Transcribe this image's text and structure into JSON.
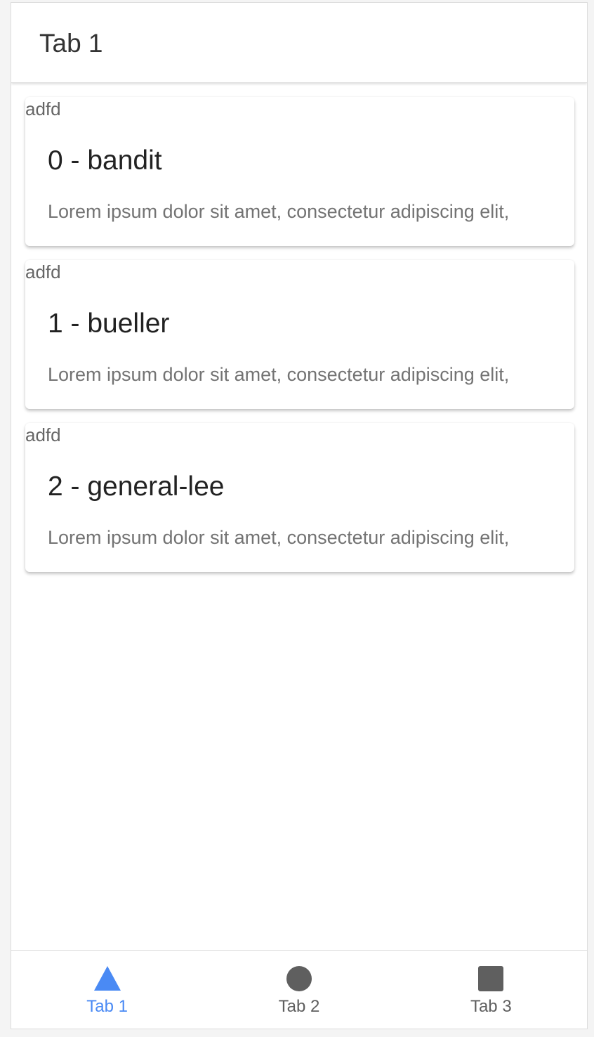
{
  "header": {
    "title": "Tab 1"
  },
  "cards": [
    {
      "tag": "adfd",
      "title": "0 - bandit",
      "body": "Lorem ipsum dolor sit amet, consectetur adipiscing elit,"
    },
    {
      "tag": "adfd",
      "title": "1 - bueller",
      "body": "Lorem ipsum dolor sit amet, consectetur adipiscing elit,"
    },
    {
      "tag": "adfd",
      "title": "2 - general-lee",
      "body": "Lorem ipsum dolor sit amet, consectetur adipiscing elit,"
    }
  ],
  "tabbar": {
    "tabs": [
      {
        "label": "Tab 1",
        "icon": "triangle-icon",
        "selected": true
      },
      {
        "label": "Tab 2",
        "icon": "circle-icon",
        "selected": false
      },
      {
        "label": "Tab 3",
        "icon": "square-icon",
        "selected": false
      }
    ]
  },
  "colors": {
    "active": "#4a8af4",
    "inactive": "#5f5f5f"
  }
}
